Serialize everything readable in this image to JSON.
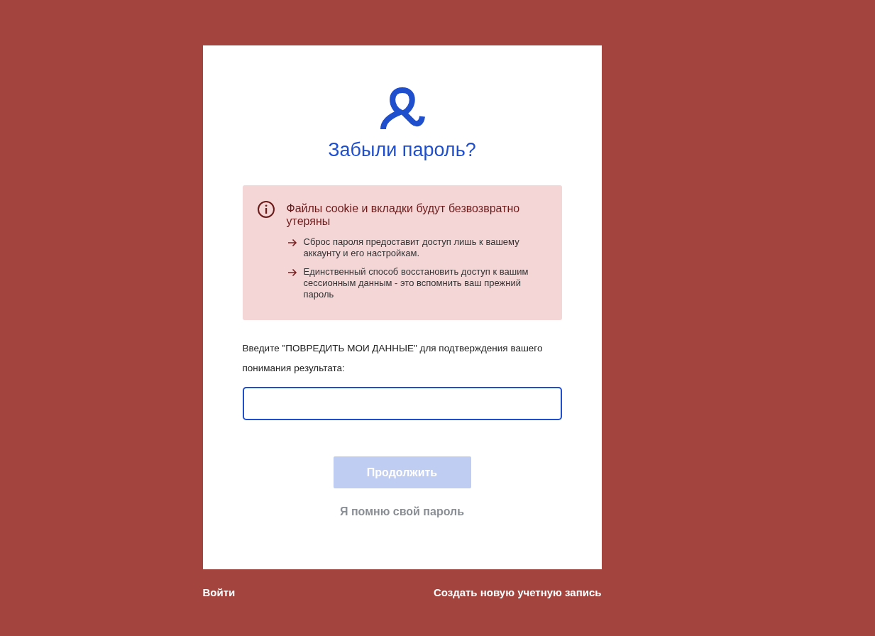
{
  "card": {
    "title": "Забыли пароль?",
    "warning": {
      "title": "Файлы cookie и вкладки будут безвозвратно утеряны",
      "items": [
        "Сброс пароля предоставит доступ лишь к вашему аккаунту и его настройкам.",
        "Единственный способ восстановить доступ к вашим сессионным данным - это вспомнить ваш прежний пароль"
      ]
    },
    "confirm_label": "Введите \"ПОВРЕДИТЬ МОИ ДАННЫЕ\" для подтверждения вашего понимания результата:",
    "continue_button": {
      "label": "Продолжить",
      "disabled": true
    },
    "remember_link": "Я помню свой пароль"
  },
  "footer": {
    "sign_in": "Войти",
    "create_account": "Создать новую учетную запись"
  }
}
